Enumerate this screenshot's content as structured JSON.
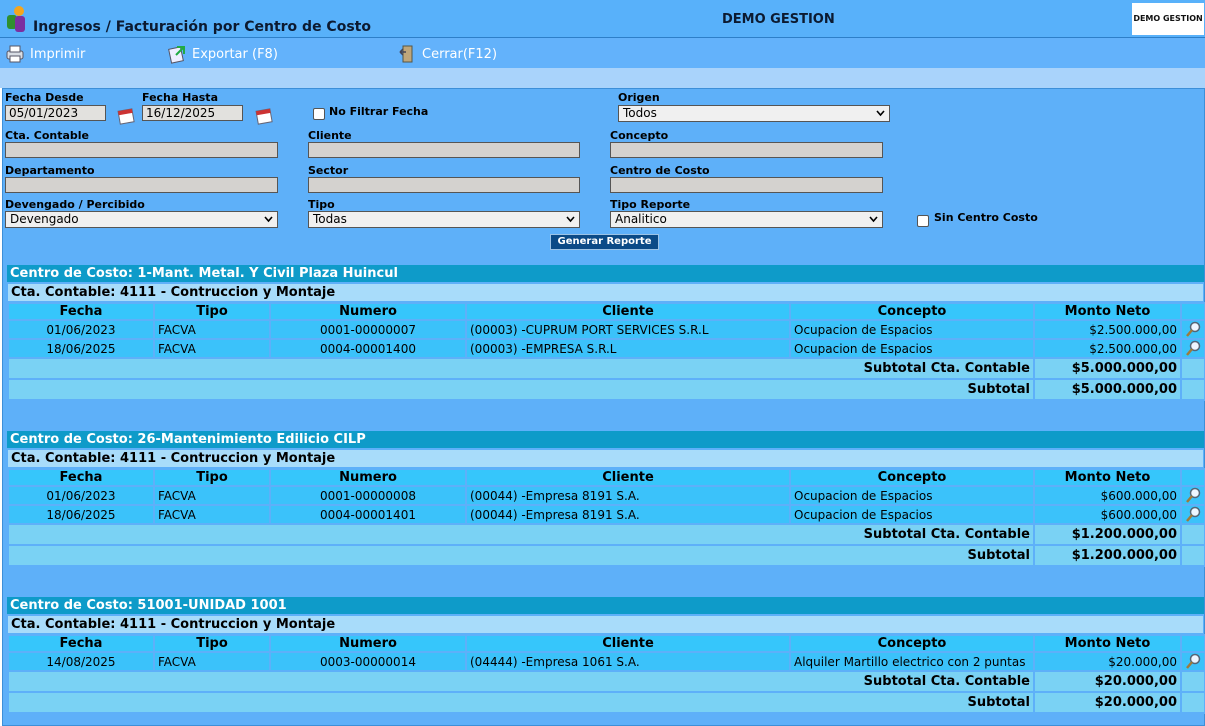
{
  "header": {
    "title": "Ingresos / Facturación por Centro de Costo",
    "company": "DEMO GESTION",
    "brand_logo_text": "DEMO GESTION"
  },
  "toolbar": {
    "print_label": "Imprimir",
    "export_label": "Exportar (F8)",
    "close_label": "Cerrar(F12)"
  },
  "filters": {
    "fecha_desde_label": "Fecha Desde",
    "fecha_desde_value": "05/01/2023",
    "fecha_hasta_label": "Fecha Hasta",
    "fecha_hasta_value": "16/12/2025",
    "no_filtrar_label": "No Filtrar Fecha",
    "origen_label": "Origen",
    "origen_value": "Todos",
    "cta_contable_label": "Cta. Contable",
    "cliente_label": "Cliente",
    "concepto_label": "Concepto",
    "departamento_label": "Departamento",
    "sector_label": "Sector",
    "centro_costo_label": "Centro de Costo",
    "devengado_label": "Devengado / Percibido",
    "devengado_value": "Devengado",
    "tipo_label": "Tipo",
    "tipo_value": "Todas",
    "tipo_reporte_label": "Tipo Reporte",
    "tipo_reporte_value": "Analitico",
    "sin_centro_label": "Sin Centro Costo",
    "generate_label": "Generar Reporte"
  },
  "columns": {
    "fecha": "Fecha",
    "tipo": "Tipo",
    "numero": "Numero",
    "cliente": "Cliente",
    "concepto": "Concepto",
    "monto": "Monto Neto"
  },
  "groups": [
    {
      "centro": "Centro de Costo: 1-Mant. Metal. Y Civil Plaza Huincul",
      "cuenta": "Cta. Contable: 4111 - Contruccion y Montaje",
      "rows": [
        {
          "fecha": "01/06/2023",
          "tipo": "FACVA",
          "numero": "0001-00000007",
          "cliente": "(00003) -CUPRUM PORT SERVICES S.R.L",
          "concepto": "Ocupacion de Espacios",
          "monto": "$2.500.000,00"
        },
        {
          "fecha": "18/06/2025",
          "tipo": "FACVA",
          "numero": "0004-00001400",
          "cliente": "(00003) -EMPRESA S.R.L",
          "concepto": "Ocupacion de Espacios",
          "monto": "$2.500.000,00"
        }
      ],
      "subtotal_cta_label": "Subtotal Cta. Contable",
      "subtotal_cta_value": "$5.000.000,00",
      "subtotal_label": "Subtotal",
      "subtotal_value": "$5.000.000,00"
    },
    {
      "centro": "Centro de Costo: 26-Mantenimiento Edilicio CILP",
      "cuenta": "Cta. Contable: 4111 - Contruccion y Montaje",
      "rows": [
        {
          "fecha": "01/06/2023",
          "tipo": "FACVA",
          "numero": "0001-00000008",
          "cliente": "(00044) -Empresa 8191 S.A.",
          "concepto": "Ocupacion de Espacios",
          "monto": "$600.000,00"
        },
        {
          "fecha": "18/06/2025",
          "tipo": "FACVA",
          "numero": "0004-00001401",
          "cliente": "(00044) -Empresa 8191 S.A.",
          "concepto": "Ocupacion de Espacios",
          "monto": "$600.000,00"
        }
      ],
      "subtotal_cta_label": "Subtotal Cta. Contable",
      "subtotal_cta_value": "$1.200.000,00",
      "subtotal_label": "Subtotal",
      "subtotal_value": "$1.200.000,00"
    },
    {
      "centro": "Centro de Costo: 51001-UNIDAD 1001",
      "cuenta": "Cta. Contable: 4111 - Contruccion y Montaje",
      "rows": [
        {
          "fecha": "14/08/2025",
          "tipo": "FACVA",
          "numero": "0003-00000014",
          "cliente": "(04444) -Empresa 1061 S.A.",
          "concepto": "Alquiler Martillo electrico con 2 puntas",
          "monto": "$20.000,00"
        }
      ],
      "subtotal_cta_label": "Subtotal Cta. Contable",
      "subtotal_cta_value": "$20.000,00",
      "subtotal_label": "Subtotal",
      "subtotal_value": "$20.000,00"
    }
  ],
  "colors": {
    "header_bg": "#58b1fa",
    "panel_bg": "#5eb0f9",
    "group_header": "#0e9bc9",
    "row_bg": "#3bc2fa",
    "subtotal_bg": "#7ad2f4"
  }
}
